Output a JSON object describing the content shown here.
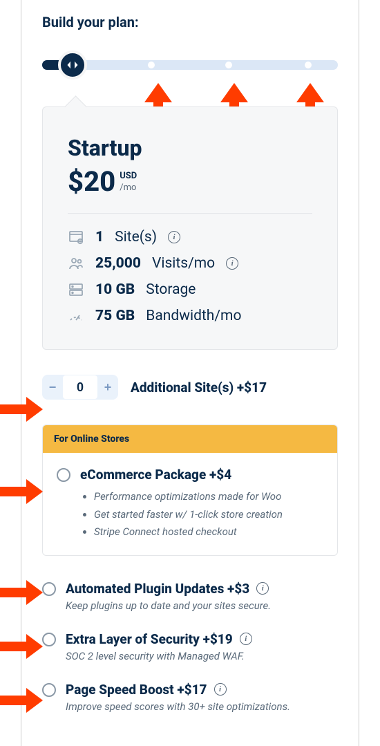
{
  "heading": "Build your plan:",
  "plan": {
    "name": "Startup",
    "price": "$20",
    "currency": "USD",
    "period": "/mo",
    "specs": [
      {
        "value": "1",
        "label": "Site(s)",
        "info": true
      },
      {
        "value": "25,000",
        "label": "Visits/mo",
        "info": true
      },
      {
        "value": "10 GB",
        "label": "Storage",
        "info": false
      },
      {
        "value": "75 GB",
        "label": "Bandwidth/mo",
        "info": false
      }
    ]
  },
  "additional_sites": {
    "value": "0",
    "label": "Additional Site(s) +$17"
  },
  "ecommerce": {
    "badge": "For Online Stores",
    "title": "eCommerce Package +$4",
    "bullets": [
      "Performance optimizations made for Woo",
      "Get started faster w/ 1-click store creation",
      "Stripe Connect hosted checkout"
    ]
  },
  "addons": [
    {
      "title": "Automated Plugin Updates +$3",
      "desc": "Keep plugins up to date and your sites secure.",
      "info": true
    },
    {
      "title": "Extra Layer of Security +$19",
      "desc": "SOC 2 level security with Managed WAF.",
      "info": true
    },
    {
      "title": "Page Speed Boost +$17",
      "desc": "Improve speed scores with 30+ site optimizations.",
      "info": true
    }
  ],
  "stepper": {
    "minus": "−",
    "plus": "+"
  }
}
